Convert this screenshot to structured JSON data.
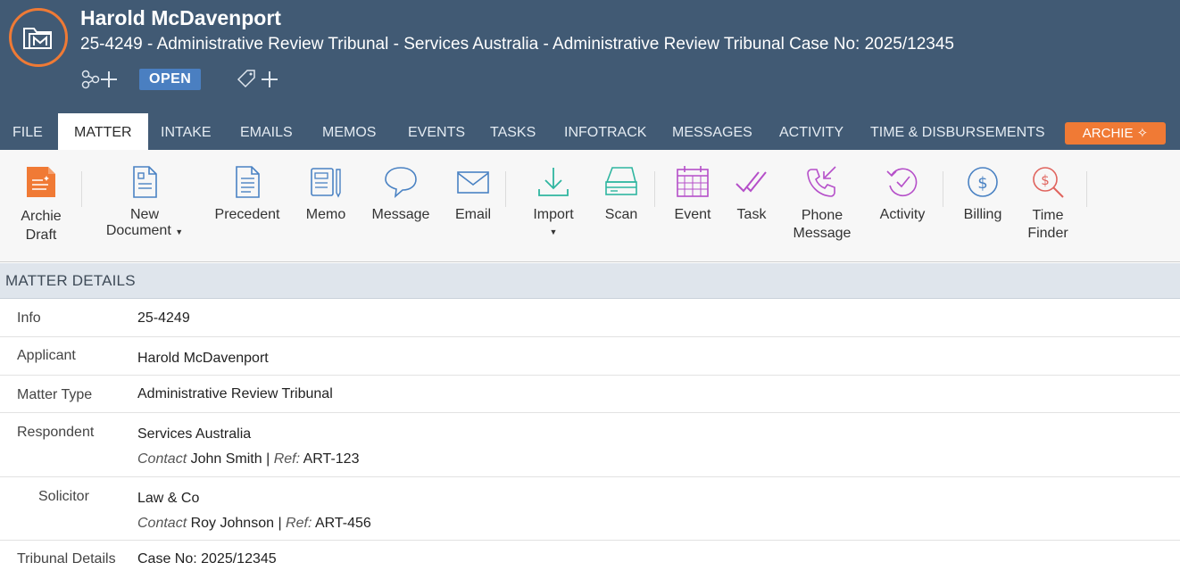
{
  "header": {
    "client_name": "Harold McDavenport",
    "matter_line": "25-4249 - Administrative Review Tribunal - Services Australia - Administrative Review Tribunal Case No: 2025/12345",
    "status": "OPEN"
  },
  "tabs": [
    {
      "label": "FILE"
    },
    {
      "label": "MATTER"
    },
    {
      "label": "INTAKE"
    },
    {
      "label": "EMAILS"
    },
    {
      "label": "MEMOS"
    },
    {
      "label": "EVENTS"
    },
    {
      "label": "TASKS"
    },
    {
      "label": "INFOTRACK"
    },
    {
      "label": "MESSAGES"
    },
    {
      "label": "ACTIVITY"
    },
    {
      "label": "TIME & DISBURSEMENTS"
    }
  ],
  "archie_tab": "ARCHIE ✧",
  "ribbon": {
    "archie_draft": {
      "line1": "Archie",
      "line2": "Draft"
    },
    "new_document": {
      "line1": "New",
      "line2": "Document"
    },
    "precedent": "Precedent",
    "memo": "Memo",
    "message": "Message",
    "email": "Email",
    "import": "Import",
    "scan": "Scan",
    "event": "Event",
    "task": "Task",
    "phone_message": {
      "line1": "Phone",
      "line2": "Message"
    },
    "activity": "Activity",
    "billing": "Billing",
    "time_finder": {
      "line1": "Time",
      "line2": "Finder"
    }
  },
  "section": {
    "title": "MATTER DETAILS"
  },
  "details": {
    "info": {
      "label": "Info",
      "value": "25-4249"
    },
    "applicant": {
      "label": "Applicant",
      "value": "Harold McDavenport"
    },
    "matter_type": {
      "label": "Matter Type",
      "value": "Administrative Review Tribunal"
    },
    "respondent": {
      "label": "Respondent",
      "value": "Services Australia",
      "contact_label": "Contact",
      "contact": "John Smith",
      "ref_label": "Ref:",
      "ref": "ART-123"
    },
    "solicitor": {
      "label": "Solicitor",
      "value": "Law & Co",
      "contact_label": "Contact",
      "contact": "Roy Johnson",
      "ref_label": "Ref:",
      "ref": "ART-456"
    },
    "tribunal": {
      "label": "Tribunal Details",
      "value": "Case No: 2025/12345"
    }
  },
  "colors": {
    "header_bg": "#415a74",
    "accent_orange": "#f07a35",
    "status_blue": "#4a7fc1"
  }
}
